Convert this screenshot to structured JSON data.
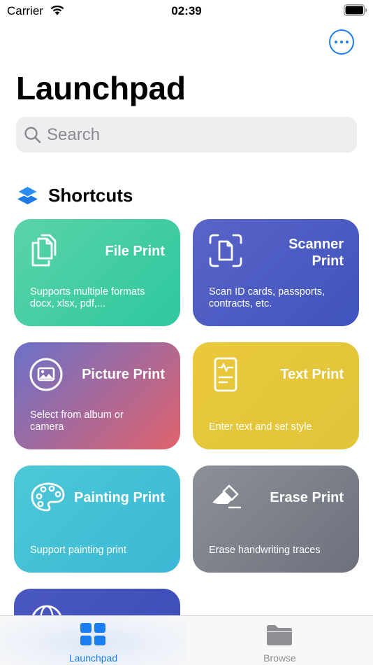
{
  "status_bar": {
    "carrier": "Carrier",
    "time": "02:39"
  },
  "page": {
    "title": "Launchpad"
  },
  "search": {
    "placeholder": "Search"
  },
  "section": {
    "title": "Shortcuts"
  },
  "cards": [
    {
      "title": "File Print",
      "description": "Supports multiple formats docx, xlsx, pdf,...",
      "icon": "documents-icon",
      "gradient": [
        "#5bd3a9",
        "#2ec79e"
      ]
    },
    {
      "title": "Scanner Print",
      "description": "Scan ID cards, passports, contracts, etc.",
      "icon": "scan-document-icon",
      "gradient": [
        "#5a64c8",
        "#4054bd"
      ]
    },
    {
      "title": "Picture Print",
      "description": "Select from album or camera",
      "icon": "picture-icon",
      "gradient": [
        "#6b71c9",
        "#e0626c"
      ]
    },
    {
      "title": "Text Print",
      "description": "Enter text and set style",
      "icon": "text-document-icon",
      "gradient": [
        "#eac83a",
        "#e0c43a"
      ]
    },
    {
      "title": "Painting Print",
      "description": "Support painting print",
      "icon": "palette-icon",
      "gradient": [
        "#4cc8d6",
        "#3ab8d4"
      ]
    },
    {
      "title": "Erase Print",
      "description": "Erase handwriting traces",
      "icon": "eraser-icon",
      "gradient": [
        "#8c9098",
        "#6c717c"
      ]
    },
    {
      "title": "",
      "description": "",
      "icon": "globe-icon",
      "gradient": [
        "#4a58c0",
        "#3b4bb5"
      ]
    }
  ],
  "tabs": [
    {
      "label": "Launchpad",
      "icon": "grid-icon",
      "active": true,
      "color": "#1a7df0"
    },
    {
      "label": "Browse",
      "icon": "folder-icon",
      "active": false,
      "color": "#8e8e93"
    }
  ]
}
